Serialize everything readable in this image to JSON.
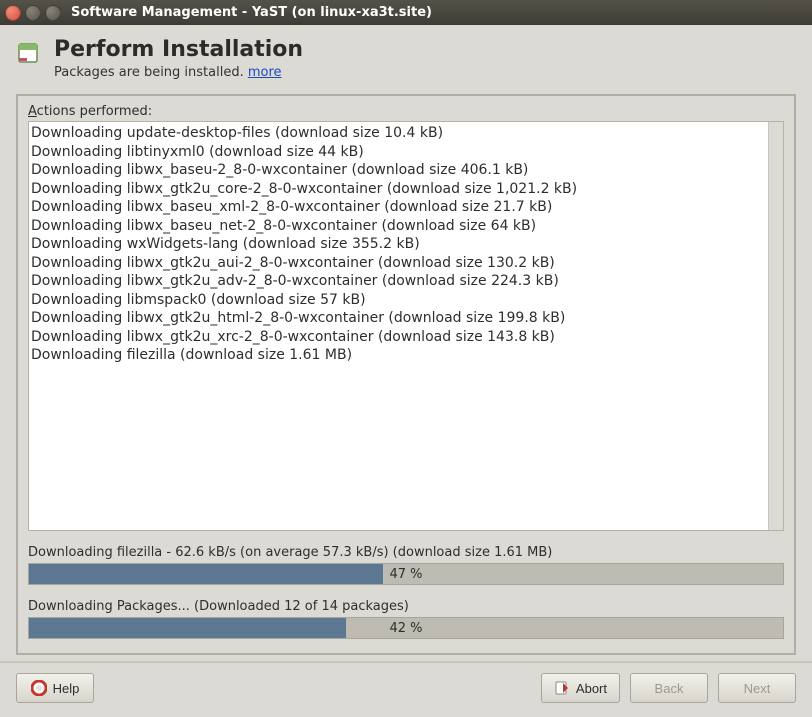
{
  "window": {
    "title": "Software Management - YaST (on linux-xa3t.site)"
  },
  "header": {
    "title": "Perform Installation",
    "subtitle_text": "Packages are being installed. ",
    "more_link": "more"
  },
  "actions_label": "ctions performed:",
  "log_lines": [
    "Downloading update-desktop-files (download size 10.4 kB)",
    "Downloading libtinyxml0 (download size 44 kB)",
    "Downloading libwx_baseu-2_8-0-wxcontainer (download size 406.1 kB)",
    "Downloading libwx_gtk2u_core-2_8-0-wxcontainer (download size 1,021.2 kB)",
    "Downloading libwx_baseu_xml-2_8-0-wxcontainer (download size 21.7 kB)",
    "Downloading libwx_baseu_net-2_8-0-wxcontainer (download size 64 kB)",
    "Downloading wxWidgets-lang (download size 355.2 kB)",
    "Downloading libwx_gtk2u_aui-2_8-0-wxcontainer (download size 130.2 kB)",
    "Downloading libwx_gtk2u_adv-2_8-0-wxcontainer (download size 224.3 kB)",
    "Downloading libmspack0 (download size 57 kB)",
    "Downloading libwx_gtk2u_html-2_8-0-wxcontainer (download size 199.8 kB)",
    "Downloading libwx_gtk2u_xrc-2_8-0-wxcontainer (download size 143.8 kB)",
    "Downloading filezilla (download size 1.61 MB)"
  ],
  "progress1": {
    "label": "Downloading filezilla - 62.6 kB/s (on average 57.3 kB/s) (download size 1.61 MB)",
    "percent": 47,
    "text": "47 %"
  },
  "progress2": {
    "label": "Downloading Packages... (Downloaded 12 of 14 packages)",
    "percent": 42,
    "text": "42 %"
  },
  "buttons": {
    "help": "Help",
    "abort": "Abort",
    "back": "Back",
    "next": "Next"
  }
}
